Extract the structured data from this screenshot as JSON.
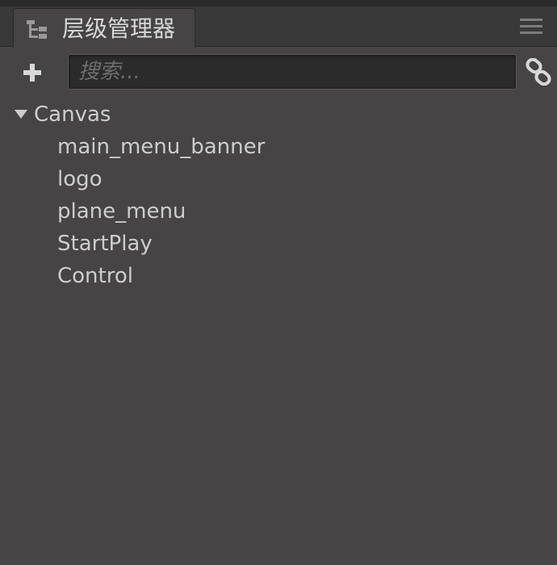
{
  "panel": {
    "title": "层级管理器"
  },
  "toolbar": {
    "add_label": "+",
    "search": {
      "placeholder": "搜索...",
      "value": ""
    }
  },
  "tree": {
    "root": {
      "label": "Canvas",
      "expanded": true,
      "children": [
        {
          "label": "main_menu_banner"
        },
        {
          "label": "logo"
        },
        {
          "label": "plane_menu"
        },
        {
          "label": "StartPlay"
        },
        {
          "label": "Control"
        }
      ]
    }
  },
  "colors": {
    "panel_bg": "#464444",
    "tabbar_bg": "#3a3939",
    "input_bg": "#2c2b2b",
    "text": "#cdcdcd"
  },
  "icons": {
    "tab": "hierarchy-icon",
    "menu": "hamburger-menu-icon",
    "add": "plus-icon",
    "link": "chain-link-icon",
    "caret": "caret-down-icon"
  }
}
